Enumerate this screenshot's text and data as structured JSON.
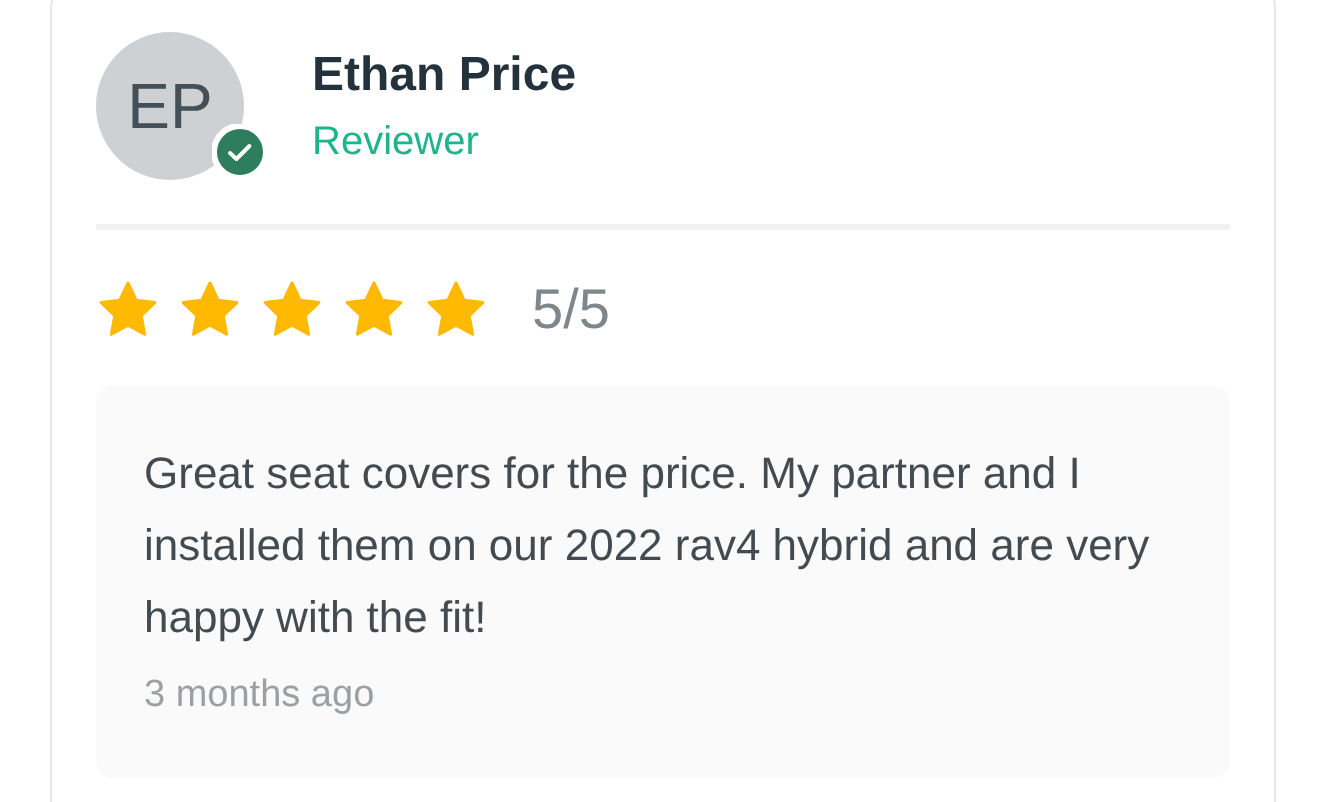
{
  "reviewer": {
    "initials": "EP",
    "verified": true,
    "name": "Ethan Price",
    "role": "Reviewer"
  },
  "rating": {
    "stars": 5,
    "score": "5/5"
  },
  "review": {
    "text": "Great seat covers for the price. My partner and I installed them on our 2022 rav4 hybrid and are very happy with the fit!",
    "time": "3 months ago"
  }
}
